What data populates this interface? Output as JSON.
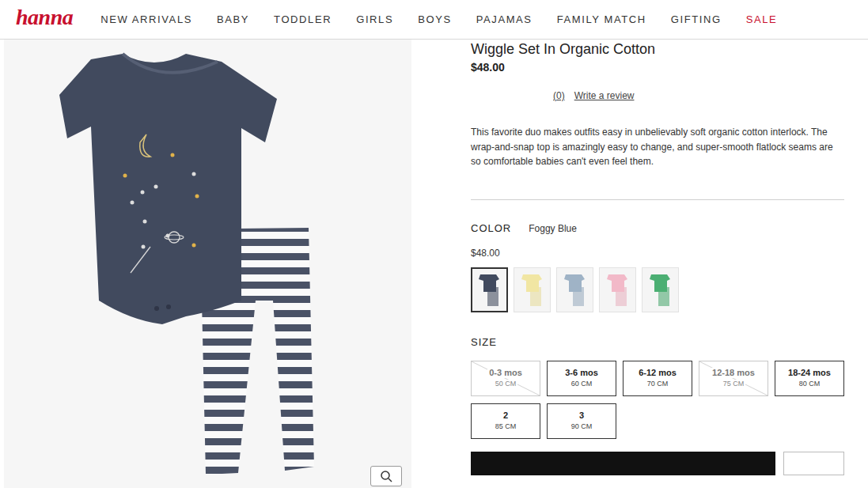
{
  "header": {
    "logo": "hanna",
    "nav": [
      {
        "label": "NEW ARRIVALS",
        "color": "#333333"
      },
      {
        "label": "BABY",
        "color": "#333333"
      },
      {
        "label": "TODDLER",
        "color": "#333333"
      },
      {
        "label": "GIRLS",
        "color": "#333333"
      },
      {
        "label": "BOYS",
        "color": "#333333"
      },
      {
        "label": "PAJAMAS",
        "color": "#333333"
      },
      {
        "label": "FAMILY MATCH",
        "color": "#333333"
      },
      {
        "label": "GIFTING",
        "color": "#333333"
      },
      {
        "label": "SALE",
        "color": "#c8102e"
      }
    ]
  },
  "product": {
    "title": "Wiggle Set In Organic Cotton",
    "price": "$48.00",
    "reviews": {
      "count": "(0)",
      "link": "Write a review"
    },
    "description": "This favorite duo makes outfits easy in unbelievably soft organic cotton interlock. The wrap-and-snap top is amazingly easy to change, and super-smooth flatlock seams are so comfortable babies can't even feel them.",
    "color": {
      "label": "COLOR",
      "value": "Foggy Blue",
      "price": "$48.00",
      "swatches": [
        {
          "selected": true,
          "color": "#414a5e"
        },
        {
          "selected": false,
          "color": "#f1e6a3"
        },
        {
          "selected": false,
          "color": "#9fb3c6"
        },
        {
          "selected": false,
          "color": "#f2b9c8"
        },
        {
          "selected": false,
          "color": "#4caf73"
        }
      ]
    },
    "size": {
      "label": "SIZE",
      "options": [
        {
          "label": "0-3 mos",
          "cm": "50 CM",
          "available": false
        },
        {
          "label": "3-6 mos",
          "cm": "60 CM",
          "available": true
        },
        {
          "label": "6-12 mos",
          "cm": "70 CM",
          "available": true
        },
        {
          "label": "12-18 mos",
          "cm": "75 CM",
          "available": false
        },
        {
          "label": "18-24 mos",
          "cm": "80 CM",
          "available": true
        },
        {
          "label": "2",
          "cm": "85 CM",
          "available": true
        },
        {
          "label": "3",
          "cm": "90 CM",
          "available": true
        }
      ]
    }
  }
}
